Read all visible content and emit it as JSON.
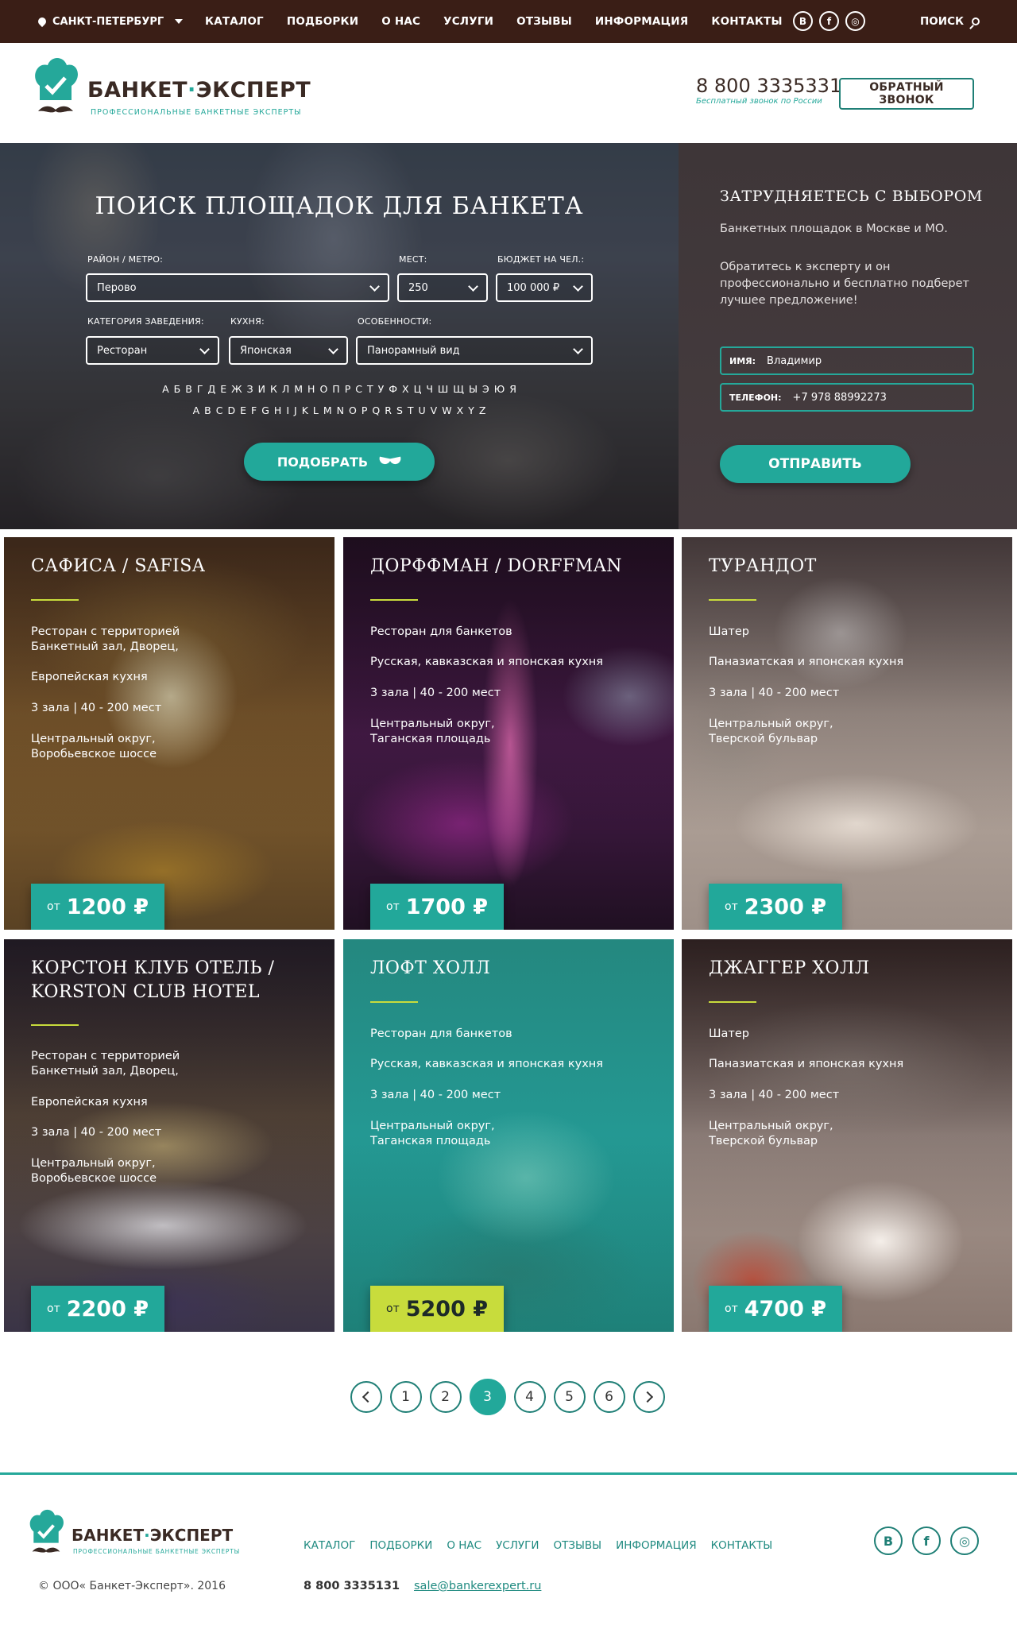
{
  "topbar": {
    "city": "САНКТ-ПЕТЕРБУРГ",
    "nav": [
      "КАТАЛОГ",
      "ПОДБОРКИ",
      "О НАС",
      "УСЛУГИ",
      "ОТЗЫВЫ",
      "ИНФОРМАЦИЯ",
      "КОНТАКТЫ"
    ],
    "socials": {
      "vk": "B",
      "facebook": "f",
      "instagram": "◎"
    },
    "search_label": "ПОИСК"
  },
  "header": {
    "brand_part1": "БАНКЕТ",
    "brand_dot": "·",
    "brand_part2": "ЭКСПЕРТ",
    "tagline": "ПРОФЕССИОНАЛЬНЫЕ БАНКЕТНЫЕ ЭКСПЕРТЫ",
    "phone": "8 800 3335331",
    "phone_note": "Бесплатный звонок по России",
    "callback_label": "ОБРАТНЫЙ ЗВОНОК"
  },
  "search": {
    "title": "ПОИСК ПЛОЩАДОК ДЛЯ БАНКЕТА",
    "district_label": "РАЙОН / МЕТРО:",
    "district_value": "Перово",
    "seats_label": "МЕСТ:",
    "seats_value": "250",
    "budget_label": "БЮДЖЕТ НА ЧЕЛ.:",
    "budget_value": "100 000 ₽",
    "category_label": "КАТЕГОРИЯ ЗАВЕДЕНИЯ:",
    "category_value": "Ресторан",
    "cuisine_label": "КУХНЯ:",
    "cuisine_value": "Японская",
    "features_label": "ОСОБЕННОСТИ:",
    "features_value": "Панорамный вид",
    "alphabet_ru": [
      "А",
      "Б",
      "В",
      "Г",
      "Д",
      "Е",
      "Ж",
      "З",
      "И",
      "К",
      "Л",
      "М",
      "Н",
      "О",
      "П",
      "Р",
      "С",
      "Т",
      "У",
      "Ф",
      "Х",
      "Ц",
      "Ч",
      "Ш",
      "Щ",
      "Ы",
      "Э",
      "Ю",
      "Я"
    ],
    "alphabet_en": [
      "A",
      "B",
      "C",
      "D",
      "E",
      "F",
      "G",
      "H",
      "I",
      "J",
      "K",
      "L",
      "M",
      "N",
      "O",
      "P",
      "Q",
      "R",
      "S",
      "T",
      "U",
      "V",
      "W",
      "X",
      "Y",
      "Z"
    ],
    "submit_label": "ПОДОБРАТЬ"
  },
  "help": {
    "title": "ЗАТРУДНЯЕТЕСЬ С ВЫБОРОМ",
    "text1": "Банкетных площадок в Москве и МО.",
    "text2": "Обратитесь к эксперту и он профессионально и бесплатно подберет лучшее предложение!",
    "name_label": "ИМЯ:",
    "name_value": "Владимир",
    "phone_label": "ТЕЛЕФОН:",
    "phone_value": "+7 978 88992273",
    "submit_label": "ОТПРАВИТЬ"
  },
  "cards": [
    {
      "title": "САФИСА / SAFISA",
      "lines": [
        "Ресторан с территорией\nБанкетный зал, Дворец,",
        "Европейская кухня",
        "3 зала  |  40 - 200 мест",
        "Центральный округ,\nВоробьевское шоссе"
      ],
      "price_prefix": "от",
      "price": "1200 ₽"
    },
    {
      "title": "ДОРФФМАН / DORFFMAN",
      "lines": [
        "Ресторан для банкетов",
        "Русская, кавказская и японская кухня",
        "3 зала  |  40 - 200 мест",
        "Центральный округ,\nТаганская площадь"
      ],
      "price_prefix": "от",
      "price": "1700 ₽"
    },
    {
      "title": "ТУРАНДОТ",
      "lines": [
        "Шатер",
        "Паназиатская и японская кухня",
        "3 зала  |  40 - 200 мест",
        "Центральный округ,\nТверской бульвар"
      ],
      "price_prefix": "от",
      "price": "2300 ₽"
    },
    {
      "title": "КОРСТОН КЛУБ ОТЕЛЬ / KORSTON CLUB HOTEL",
      "lines": [
        "Ресторан с территорией\nБанкетный зал, Дворец,",
        "Европейская кухня",
        "3 зала  |  40 - 200 мест",
        "Центральный округ,\nВоробьевское шоссе"
      ],
      "price_prefix": "от",
      "price": "2200 ₽"
    },
    {
      "title": "ЛОФТ ХОЛЛ",
      "lines": [
        "Ресторан для банкетов",
        "Русская, кавказская и японская кухня",
        "3 зала  |  40 - 200 мест",
        "Центральный округ,\nТаганская площадь"
      ],
      "price_prefix": "от",
      "price": "5200 ₽"
    },
    {
      "title": "ДЖАГГЕР ХОЛЛ",
      "lines": [
        "Шатер",
        "Паназиатская и японская кухня",
        "3 зала  |  40 - 200 мест",
        "Центральный округ,\nТверской бульвар"
      ],
      "price_prefix": "от",
      "price": "4700 ₽"
    }
  ],
  "pagination": {
    "pages": [
      "1",
      "2",
      "3",
      "4",
      "5",
      "6"
    ],
    "current": "3"
  },
  "footer": {
    "brand_part1": "БАНКЕТ",
    "brand_dot": "·",
    "brand_part2": "ЭКСПЕРТ",
    "tagline": "ПРОФЕССИОНАЛЬНЫЕ БАНКЕТНЫЕ ЭКСПЕРТЫ",
    "nav": [
      "КАТАЛОГ",
      "ПОДБОРКИ",
      "О НАС",
      "УСЛУГИ",
      "ОТЗЫВЫ",
      "ИНФОРМАЦИЯ",
      "КОНТАКТЫ"
    ],
    "socials": {
      "vk": "B",
      "facebook": "f",
      "instagram": "◎"
    },
    "copyright": "© ООО« Банкет-Эксперт». 2016",
    "phone": "8 800 3335131",
    "email": "sale@bankerexpert.ru"
  },
  "colors": {
    "accent": "#22a89a",
    "dark_brown": "#3a1e16",
    "lime": "#c8dc3c",
    "panel": "#433a3c"
  }
}
